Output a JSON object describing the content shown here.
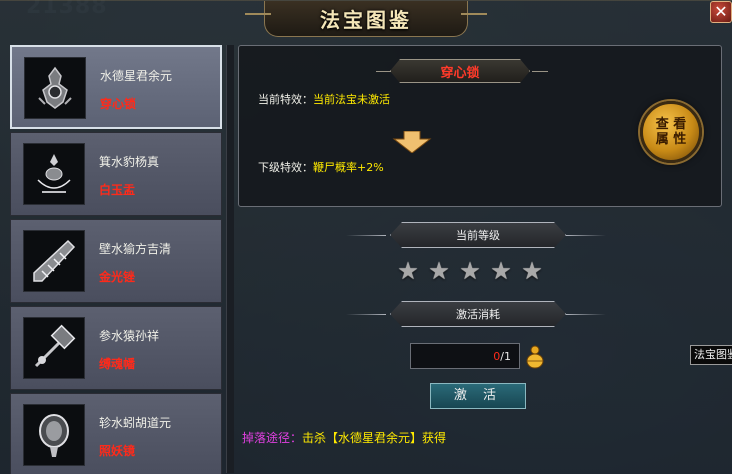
{
  "background": {
    "score_text": "21388"
  },
  "window": {
    "title": "法宝图鉴",
    "close_label": "✕"
  },
  "list": {
    "items": [
      {
        "name": "水德星君余元",
        "treasure": "穿心锁",
        "selected": true,
        "icon": "lock-icon"
      },
      {
        "name": "箕水豹杨真",
        "treasure": "白玉盂",
        "selected": false,
        "icon": "bowl-icon"
      },
      {
        "name": "壁水㺄方吉清",
        "treasure": "金光锉",
        "selected": false,
        "icon": "file-icon"
      },
      {
        "name": "参水猿孙祥",
        "treasure": "缚魂幡",
        "selected": false,
        "icon": "banner-icon"
      },
      {
        "name": "轸水蚓胡道元",
        "treasure": "照妖镜",
        "selected": false,
        "icon": "mirror-icon"
      }
    ]
  },
  "detail": {
    "treasure_name": "穿心锁",
    "current_effect_label": "当前特效：",
    "current_effect_value": "当前法宝未激活",
    "next_effect_label": "下级特效：",
    "next_effect_value": "鞭尸概率+2%",
    "view_attr_line1": "查 看",
    "view_attr_line2": "属 性"
  },
  "level": {
    "section_label": "当前等级",
    "stars_total": 5,
    "stars_filled": 0,
    "star_glyph": "★"
  },
  "activation": {
    "section_label": "激活消耗",
    "cost_current": "0",
    "cost_sep": "/1",
    "button_label": "激 活"
  },
  "drop": {
    "label": "掉落途径：",
    "value": "击杀【水德星君余元】获得"
  },
  "tooltip": {
    "text": "法宝图鉴"
  },
  "colors": {
    "accent_red": "#ff2a1a",
    "accent_yellow": "#ffea00",
    "drop_label_magenta": "#e040e0",
    "button_teal": "#2a6a78",
    "gold": "#c88a16"
  }
}
